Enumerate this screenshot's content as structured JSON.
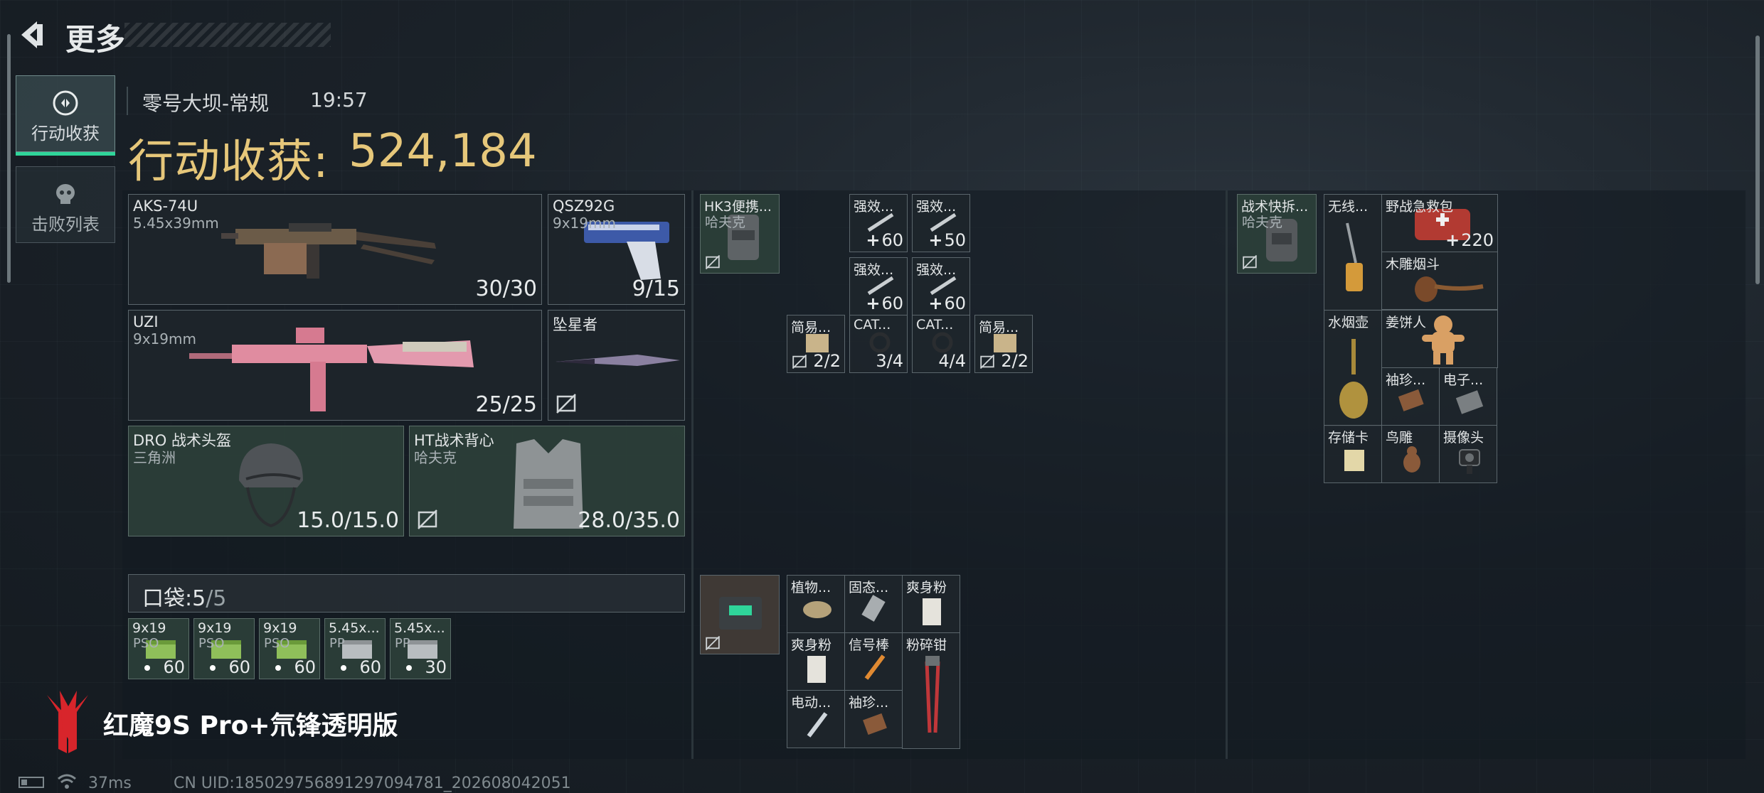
{
  "header": {
    "title": "更多",
    "map_name": "零号大坝-常规",
    "duration": "19:57",
    "haul_label": "行动收获:",
    "haul_value": "524,184"
  },
  "side_tabs": [
    {
      "label": "行动收获",
      "icon": "loot-icon",
      "active": true
    },
    {
      "label": "击败列表",
      "icon": "skull-icon",
      "active": false
    }
  ],
  "equipment": {
    "primary": {
      "name": "AKS-74U",
      "ammo": "5.45x39mm",
      "count": "30/30"
    },
    "sidearm": {
      "name": "QSZ92G",
      "ammo": "9x19mm",
      "count": "9/15"
    },
    "secondary": {
      "name": "UZI",
      "ammo": "9x19mm",
      "count": "25/25"
    },
    "melee": {
      "name": "坠星者"
    },
    "helmet": {
      "name": "DRO 战术头盔",
      "brand": "三角洲",
      "durability": "15.0/15.0"
    },
    "armor": {
      "name": "HT战术背心",
      "brand": "哈夫克",
      "durability": "28.0/35.0"
    }
  },
  "pouch": {
    "label": "口袋:",
    "count": "5",
    "capacity": "/5",
    "items": [
      {
        "name": "9x19",
        "sub": "PSO",
        "qty": "60"
      },
      {
        "name": "9x19",
        "sub": "PSO",
        "qty": "60"
      },
      {
        "name": "9x19",
        "sub": "PSO",
        "qty": "60"
      },
      {
        "name": "5.45x...",
        "sub": "PP",
        "qty": "60"
      },
      {
        "name": "5.45x...",
        "sub": "PP",
        "qty": "30"
      }
    ]
  },
  "rig": {
    "container": {
      "name": "HK3便携...",
      "brand": "哈夫克"
    },
    "items": [
      {
        "name": "强效...",
        "qty": "60"
      },
      {
        "name": "强效...",
        "qty": "50"
      },
      {
        "name": "强效...",
        "qty": "60"
      },
      {
        "name": "强效...",
        "qty": "60"
      },
      {
        "name": "简易...",
        "qty": "2/2"
      },
      {
        "name": "CAT...",
        "qty": "3/4"
      },
      {
        "name": "CAT...",
        "qty": "4/4"
      },
      {
        "name": "简易...",
        "qty": "2/2"
      }
    ]
  },
  "safebox": {
    "items": [
      {
        "name": "植物..."
      },
      {
        "name": "固态..."
      },
      {
        "name": "爽身粉"
      },
      {
        "name": "爽身粉"
      },
      {
        "name": "信号棒"
      },
      {
        "name": "粉碎钳"
      },
      {
        "name": "电动..."
      },
      {
        "name": "袖珍..."
      }
    ]
  },
  "backpack": {
    "container": {
      "name": "战术快拆...",
      "brand": "哈夫克"
    },
    "items": [
      {
        "name": "无线..."
      },
      {
        "name": "野战急救包",
        "qty": "220"
      },
      {
        "name": "木雕烟斗"
      },
      {
        "name": "水烟壶"
      },
      {
        "name": "姜饼人"
      },
      {
        "name": "袖珍..."
      },
      {
        "name": "电子..."
      },
      {
        "name": "存储卡"
      },
      {
        "name": "鸟雕"
      },
      {
        "name": "摄像头"
      }
    ]
  },
  "footer": {
    "brand": "红魔9S Pro+氘锋透明版",
    "ping": "37ms",
    "uid": "CN UID:1850297568912970947​81_202608042051"
  },
  "colors": {
    "accent": "#e6c77a",
    "active_tab": "#2fd59a",
    "slot_green": "#2c403a"
  }
}
